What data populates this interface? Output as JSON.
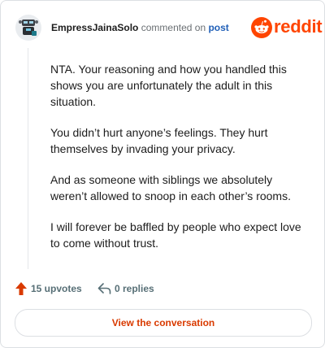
{
  "header": {
    "username": "EmpressJainaSolo",
    "verb": "commented on",
    "target": "post",
    "brand": "reddit"
  },
  "comment": {
    "paragraphs": [
      "NTA. Your reasoning and how you handled this shows you are unfortunately the adult in this situation.",
      "You didn’t hurt anyone’s feelings. They hurt themselves by invading your privacy.",
      "And as someone with siblings we absolutely weren’t allowed to snoop in each other’s rooms.",
      "I will forever be baffled by people who expect love to come without trust."
    ]
  },
  "actions": {
    "upvotes": "15 upvotes",
    "replies": "0 replies"
  },
  "cta": {
    "label": "View the conversation"
  },
  "colors": {
    "brand": "#ff4500",
    "link": "#2160b8",
    "cta_text": "#d93a00"
  },
  "icons": {
    "upvote": "upvote-arrow-icon",
    "reply": "reply-arrow-icon",
    "brand": "reddit-snoo-icon"
  }
}
